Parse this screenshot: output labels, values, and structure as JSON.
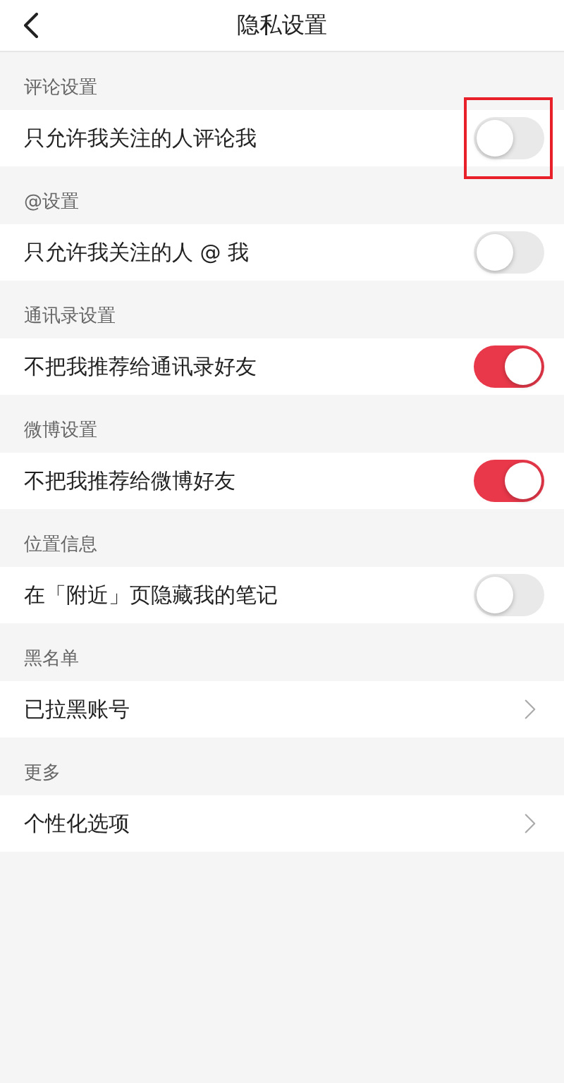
{
  "title": "隐私设置",
  "sections": [
    {
      "header": "评论设置",
      "rows": [
        {
          "label": "只允许我关注的人评论我",
          "kind": "toggle",
          "on": false,
          "highlighted": true
        }
      ]
    },
    {
      "header": "@设置",
      "rows": [
        {
          "label": "只允许我关注的人 @ 我",
          "kind": "toggle",
          "on": false,
          "highlighted": false
        }
      ]
    },
    {
      "header": "通讯录设置",
      "rows": [
        {
          "label": "不把我推荐给通讯录好友",
          "kind": "toggle",
          "on": true,
          "highlighted": false
        }
      ]
    },
    {
      "header": "微博设置",
      "rows": [
        {
          "label": "不把我推荐给微博好友",
          "kind": "toggle",
          "on": true,
          "highlighted": false
        }
      ]
    },
    {
      "header": "位置信息",
      "rows": [
        {
          "label": "在「附近」页隐藏我的笔记",
          "kind": "toggle",
          "on": false,
          "highlighted": false
        }
      ]
    },
    {
      "header": "黑名单",
      "rows": [
        {
          "label": "已拉黑账号",
          "kind": "link"
        }
      ]
    },
    {
      "header": "更多",
      "rows": [
        {
          "label": "个性化选项",
          "kind": "link"
        }
      ]
    }
  ]
}
